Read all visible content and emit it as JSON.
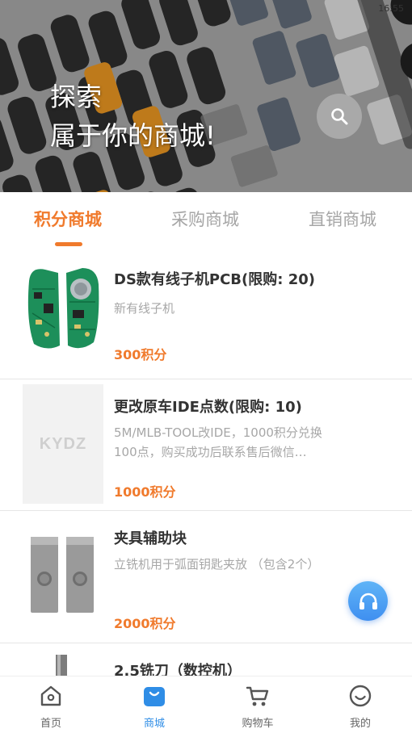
{
  "status_bar": {
    "time": "16:55"
  },
  "hero": {
    "line1": "探索",
    "line2": "属于你的商城!"
  },
  "tabs": [
    {
      "label": "积分商城",
      "active": true
    },
    {
      "label": "采购商城",
      "active": false
    },
    {
      "label": "直销商城",
      "active": false
    }
  ],
  "products": [
    {
      "title": "DS款有线子机PCB(限购: 20)",
      "desc": "新有线子机",
      "price": "300积分",
      "image": "pcb-board"
    },
    {
      "title": "更改原车IDE点数(限购: 10)",
      "desc": "5M/MLB-TOOL改IDE，1000积分兑换100点，购买成功后联系售后微信…",
      "price": "1000积分",
      "image": "kydz-logo",
      "image_text": "KYDZ"
    },
    {
      "title": "夹具辅助块",
      "desc": "立铣机用于弧面钥匙夹放 （包含2个）",
      "price": "2000积分",
      "image": "metal-blocks"
    },
    {
      "title": "2.5铣刀（数控机）",
      "desc": "",
      "price": "",
      "image": "cutter"
    }
  ],
  "bottom_nav": [
    {
      "label": "首页",
      "icon": "home-icon",
      "active": false
    },
    {
      "label": "商城",
      "icon": "shop-bag-icon",
      "active": true
    },
    {
      "label": "购物车",
      "icon": "cart-icon",
      "active": false
    },
    {
      "label": "我的",
      "icon": "smile-face-icon",
      "active": false
    }
  ],
  "colors": {
    "accent": "#f07a2c",
    "nav_active": "#2f8de6",
    "muted": "#a7a7a7",
    "support": "#4a9df2"
  }
}
